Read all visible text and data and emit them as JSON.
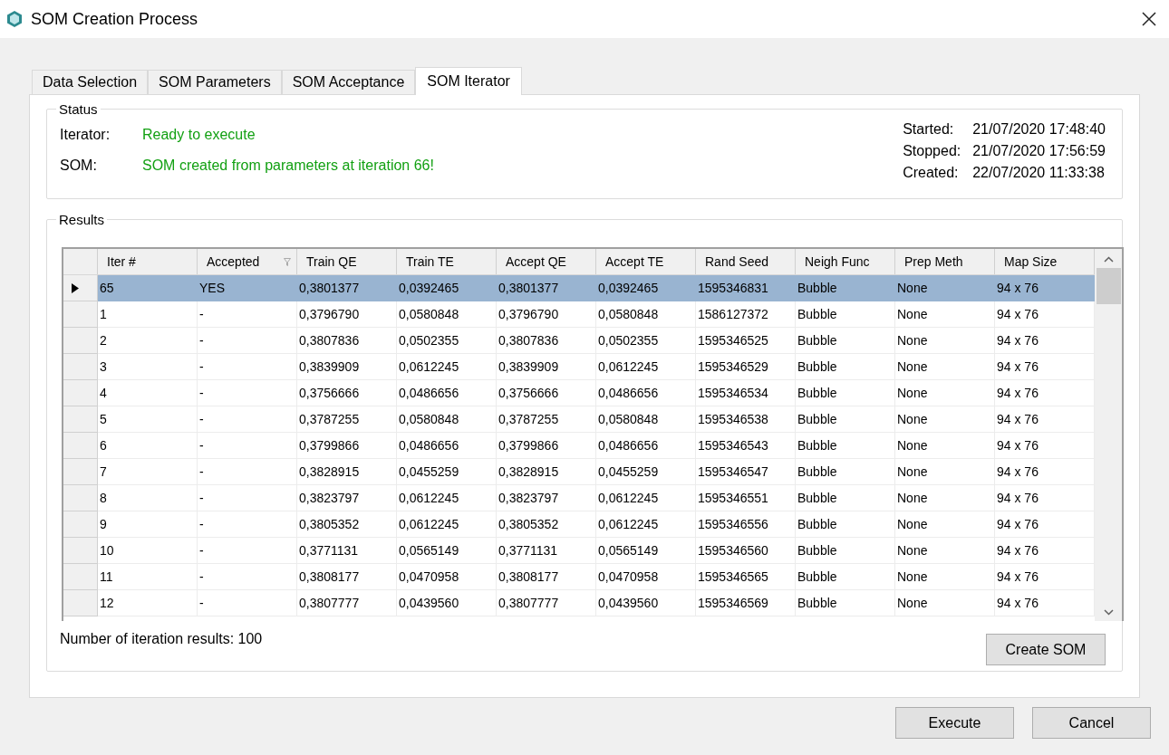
{
  "window": {
    "title": "SOM Creation Process"
  },
  "tabs": [
    {
      "label": "Data Selection",
      "selected": false
    },
    {
      "label": "SOM Parameters",
      "selected": false
    },
    {
      "label": "SOM Acceptance",
      "selected": false
    },
    {
      "label": "SOM Iterator",
      "selected": true
    }
  ],
  "status": {
    "title": "Status",
    "lines": [
      {
        "label": "Iterator:",
        "value": "Ready to execute"
      },
      {
        "label": "SOM:",
        "value": "SOM created from parameters at iteration 66!"
      }
    ],
    "times": [
      {
        "label": "Started:",
        "value": "21/07/2020 17:48:40"
      },
      {
        "label": "Stopped:",
        "value": "21/07/2020 17:56:59"
      },
      {
        "label": "Created:",
        "value": "22/07/2020 11:33:38"
      }
    ]
  },
  "results": {
    "title": "Results",
    "columns": [
      {
        "label": "Iter #",
        "filtered": false
      },
      {
        "label": "Accepted",
        "filtered": true
      },
      {
        "label": "Train QE",
        "filtered": false
      },
      {
        "label": "Train TE",
        "filtered": false
      },
      {
        "label": "Accept QE",
        "filtered": false
      },
      {
        "label": "Accept TE",
        "filtered": false
      },
      {
        "label": "Rand Seed",
        "filtered": false
      },
      {
        "label": "Neigh Func",
        "filtered": false
      },
      {
        "label": "Prep Meth",
        "filtered": false
      },
      {
        "label": "Map Size",
        "filtered": false
      }
    ],
    "rows": [
      {
        "selected": true,
        "cells": [
          "65",
          "YES",
          "0,3801377",
          "0,0392465",
          "0,3801377",
          "0,0392465",
          "1595346831",
          "Bubble",
          "None",
          "94 x 76"
        ]
      },
      {
        "selected": false,
        "cells": [
          "1",
          "-",
          "0,3796790",
          "0,0580848",
          "0,3796790",
          "0,0580848",
          "1586127372",
          "Bubble",
          "None",
          "94 x 76"
        ]
      },
      {
        "selected": false,
        "cells": [
          "2",
          "-",
          "0,3807836",
          "0,0502355",
          "0,3807836",
          "0,0502355",
          "1595346525",
          "Bubble",
          "None",
          "94 x 76"
        ]
      },
      {
        "selected": false,
        "cells": [
          "3",
          "-",
          "0,3839909",
          "0,0612245",
          "0,3839909",
          "0,0612245",
          "1595346529",
          "Bubble",
          "None",
          "94 x 76"
        ]
      },
      {
        "selected": false,
        "cells": [
          "4",
          "-",
          "0,3756666",
          "0,0486656",
          "0,3756666",
          "0,0486656",
          "1595346534",
          "Bubble",
          "None",
          "94 x 76"
        ]
      },
      {
        "selected": false,
        "cells": [
          "5",
          "-",
          "0,3787255",
          "0,0580848",
          "0,3787255",
          "0,0580848",
          "1595346538",
          "Bubble",
          "None",
          "94 x 76"
        ]
      },
      {
        "selected": false,
        "cells": [
          "6",
          "-",
          "0,3799866",
          "0,0486656",
          "0,3799866",
          "0,0486656",
          "1595346543",
          "Bubble",
          "None",
          "94 x 76"
        ]
      },
      {
        "selected": false,
        "cells": [
          "7",
          "-",
          "0,3828915",
          "0,0455259",
          "0,3828915",
          "0,0455259",
          "1595346547",
          "Bubble",
          "None",
          "94 x 76"
        ]
      },
      {
        "selected": false,
        "cells": [
          "8",
          "-",
          "0,3823797",
          "0,0612245",
          "0,3823797",
          "0,0612245",
          "1595346551",
          "Bubble",
          "None",
          "94 x 76"
        ]
      },
      {
        "selected": false,
        "cells": [
          "9",
          "-",
          "0,3805352",
          "0,0612245",
          "0,3805352",
          "0,0612245",
          "1595346556",
          "Bubble",
          "None",
          "94 x 76"
        ]
      },
      {
        "selected": false,
        "cells": [
          "10",
          "-",
          "0,3771131",
          "0,0565149",
          "0,3771131",
          "0,0565149",
          "1595346560",
          "Bubble",
          "None",
          "94 x 76"
        ]
      },
      {
        "selected": false,
        "cells": [
          "11",
          "-",
          "0,3808177",
          "0,0470958",
          "0,3808177",
          "0,0470958",
          "1595346565",
          "Bubble",
          "None",
          "94 x 76"
        ]
      },
      {
        "selected": false,
        "cells": [
          "12",
          "-",
          "0,3807777",
          "0,0439560",
          "0,3807777",
          "0,0439560",
          "1595346569",
          "Bubble",
          "None",
          "94 x 76"
        ]
      }
    ],
    "count": "Number of iteration results: 100",
    "create_button": "Create SOM"
  },
  "buttons": [
    "Execute",
    "Cancel"
  ]
}
